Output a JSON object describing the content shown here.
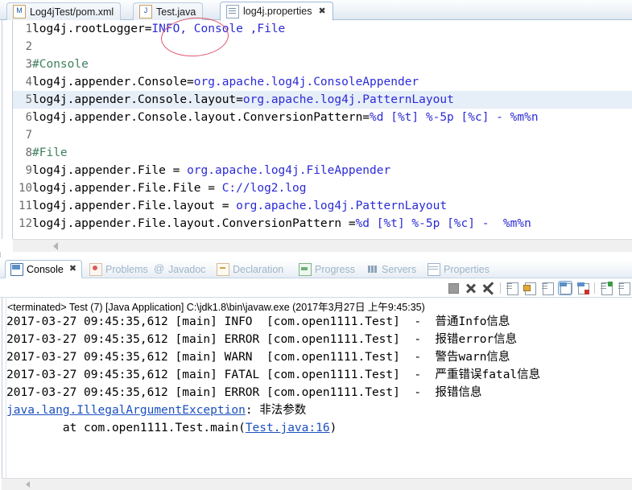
{
  "editor": {
    "tabs": [
      {
        "label": "Log4jTest/pom.xml",
        "icon": "xml-file-icon",
        "active": false,
        "closable": false
      },
      {
        "label": "Test.java",
        "icon": "java-file-icon",
        "active": false,
        "closable": false
      },
      {
        "label": "log4j.properties",
        "icon": "properties-file-icon",
        "active": true,
        "closable": true,
        "close_glyph": "✖"
      }
    ],
    "current_line": 5,
    "lines": [
      {
        "no": "1",
        "parts": [
          {
            "t": "log4j.rootLogger",
            "c": "plain"
          },
          {
            "t": "=",
            "c": "plain"
          },
          {
            "t": "INFO, Console ,File",
            "c": "val"
          }
        ]
      },
      {
        "no": "2",
        "parts": []
      },
      {
        "no": "3",
        "parts": [
          {
            "t": "#Console",
            "c": "cmt"
          }
        ]
      },
      {
        "no": "4",
        "parts": [
          {
            "t": "log4j.appender.Console=",
            "c": "plain"
          },
          {
            "t": "org.apache.log4j.ConsoleAppender",
            "c": "val"
          }
        ]
      },
      {
        "no": "5",
        "parts": [
          {
            "t": "log4j.appender.Console.layout=",
            "c": "plain"
          },
          {
            "t": "org.apache.log4j.PatternLayout",
            "c": "val"
          }
        ]
      },
      {
        "no": "6",
        "parts": [
          {
            "t": "log4j.appender.Console.layout.ConversionPattern=",
            "c": "plain"
          },
          {
            "t": "%d [%t] %-5p [%c] - %m%n",
            "c": "val"
          }
        ]
      },
      {
        "no": "7",
        "parts": []
      },
      {
        "no": "8",
        "parts": [
          {
            "t": "#File",
            "c": "cmt"
          }
        ]
      },
      {
        "no": "9",
        "parts": [
          {
            "t": "log4j.appender.File = ",
            "c": "plain"
          },
          {
            "t": "org.apache.log4j.FileAppender",
            "c": "val"
          }
        ]
      },
      {
        "no": "10",
        "parts": [
          {
            "t": "log4j.appender.File.File = ",
            "c": "plain"
          },
          {
            "t": "C://log2.log",
            "c": "val"
          }
        ]
      },
      {
        "no": "11",
        "parts": [
          {
            "t": "log4j.appender.File.layout = ",
            "c": "plain"
          },
          {
            "t": "org.apache.log4j.PatternLayout",
            "c": "val"
          }
        ]
      },
      {
        "no": "12",
        "parts": [
          {
            "t": "log4j.appender.File.layout.ConversionPattern =",
            "c": "plain"
          },
          {
            "t": "%d [%t] %-5p [%c] -  %m%n",
            "c": "val"
          }
        ]
      }
    ]
  },
  "annotation": {
    "shape": "ellipse",
    "color": "#e0566b",
    "targets_text": "=INFO,"
  },
  "console": {
    "tabs": [
      {
        "label": "Console",
        "icon": "console-icon",
        "active": true,
        "close_glyph": "✖"
      },
      {
        "label": "Problems",
        "icon": "problems-icon",
        "active": false
      },
      {
        "label": "Javadoc",
        "icon": "javadoc-icon",
        "active": false
      },
      {
        "label": "Declaration",
        "icon": "declaration-icon",
        "active": false
      },
      {
        "label": "Progress",
        "icon": "progress-icon",
        "active": false
      },
      {
        "label": "Servers",
        "icon": "servers-icon",
        "active": false
      },
      {
        "label": "Properties",
        "icon": "properties-icon",
        "active": false
      }
    ],
    "toolbar": [
      {
        "name": "terminate-button",
        "kind": "stop"
      },
      {
        "name": "remove-launch-button",
        "kind": "x"
      },
      {
        "name": "remove-all-terminated-button",
        "kind": "xx"
      },
      {
        "name": "separator-1",
        "kind": "sep"
      },
      {
        "name": "clear-console-button",
        "kind": "doc-x"
      },
      {
        "name": "scroll-lock-button",
        "kind": "lock"
      },
      {
        "name": "word-wrap-button",
        "kind": "doc-wrap"
      },
      {
        "name": "pin-console-button",
        "kind": "pinned"
      },
      {
        "name": "display-selected-console-button",
        "kind": "select-console"
      },
      {
        "name": "separator-2",
        "kind": "sep"
      },
      {
        "name": "open-console-button",
        "kind": "open-console"
      },
      {
        "name": "console-menu-button",
        "kind": "menu"
      }
    ],
    "terminated_line": "<terminated> Test (7) [Java Application] C:\\jdk1.8\\bin\\javaw.exe (2017年3月27日 上午9:45:35)",
    "log_lines": [
      "2017-03-27 09:45:35,612 [main] INFO  [com.open1111.Test]  -  普通Info信息",
      "2017-03-27 09:45:35,612 [main] ERROR [com.open1111.Test]  -  报错error信息",
      "2017-03-27 09:45:35,612 [main] WARN  [com.open1111.Test]  -  警告warn信息",
      "2017-03-27 09:45:35,612 [main] FATAL [com.open1111.Test]  -  严重错误fatal信息",
      "2017-03-27 09:45:35,612 [main] ERROR [com.open1111.Test]  -  报错信息"
    ],
    "exception": {
      "type": "java.lang.IllegalArgumentException",
      "separator": ": ",
      "message": "非法参数",
      "stack_prefix": "        at com.open1111.Test.main(",
      "stack_link": "Test.java:16",
      "stack_suffix": ")"
    }
  }
}
